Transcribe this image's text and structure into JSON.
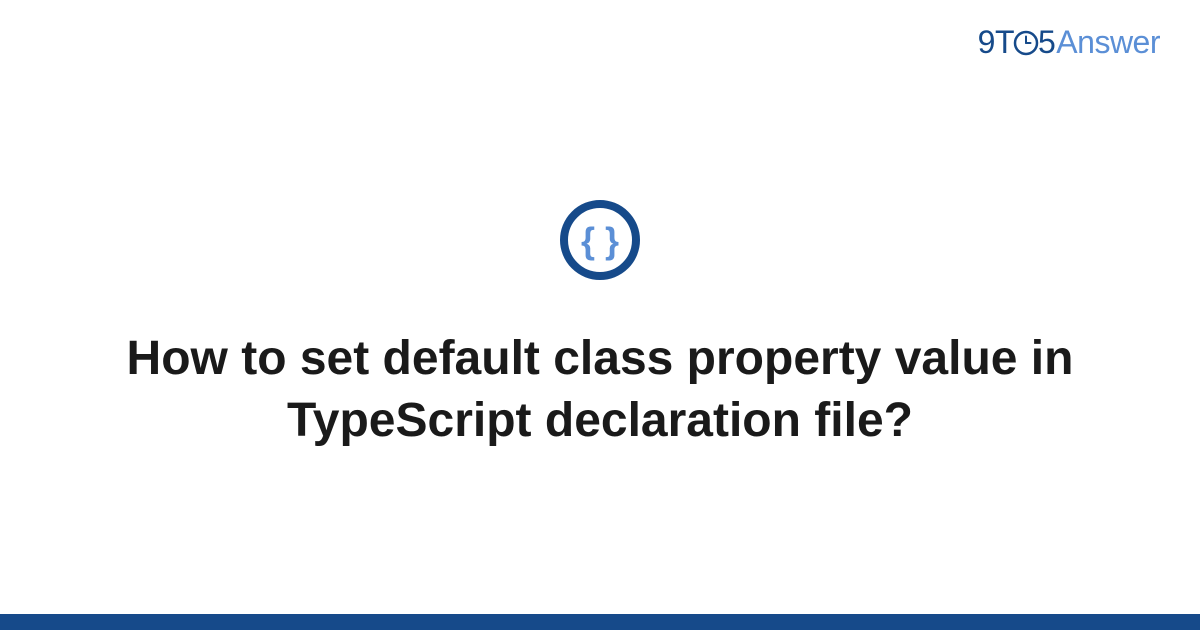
{
  "brand": {
    "part1": "9T",
    "part2": "5",
    "part3": "Answer"
  },
  "category": {
    "name": "code",
    "icon": "braces-icon"
  },
  "question": {
    "title": "How to set default class property value in TypeScript declaration file?"
  },
  "colors": {
    "primary": "#164a8a",
    "accent": "#5b8fd6",
    "text": "#1a1a1a"
  }
}
